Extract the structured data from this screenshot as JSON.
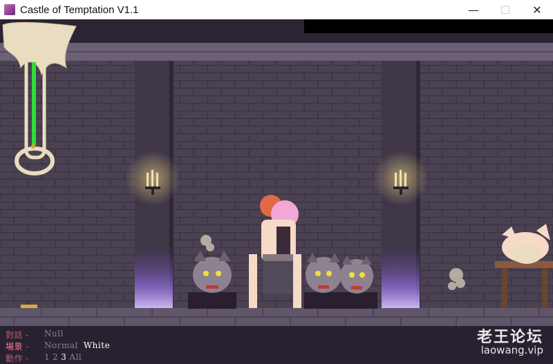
{
  "window": {
    "title": "Castle of Temptation V1.1",
    "minimize_glyph": "—",
    "maximize_glyph": "☐",
    "close_glyph": "✕"
  },
  "hud": {
    "dialog": {
      "label": "對話",
      "sep": "-",
      "value": "Null"
    },
    "scene": {
      "label": "場景",
      "sep": "-",
      "options": [
        "Normal",
        "White"
      ],
      "active": "White"
    },
    "action": {
      "label": "動作",
      "sep": "-",
      "options": [
        "1",
        "2",
        "3",
        "All"
      ],
      "active": "3"
    }
  },
  "watermark": {
    "text": "老王论坛",
    "url": "laowang.vip"
  },
  "colors": {
    "wall": "#4a4152",
    "brick_line": "#3b3342",
    "floor": "#605669",
    "portal": "#9b74f0",
    "candle": "#ffe68a"
  }
}
